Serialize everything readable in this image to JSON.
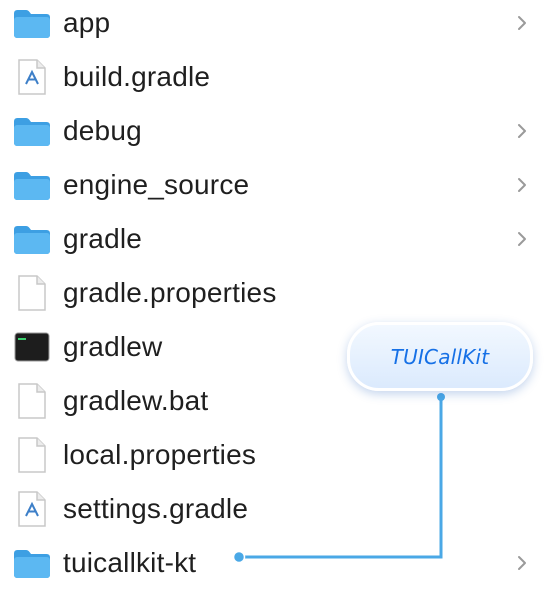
{
  "files": [
    {
      "name": "app",
      "type": "folder",
      "icon": "folder-icon",
      "expandable": true
    },
    {
      "name": "build.gradle",
      "type": "gradle",
      "icon": "gradle-file-icon",
      "expandable": false
    },
    {
      "name": "debug",
      "type": "folder",
      "icon": "folder-icon",
      "expandable": true
    },
    {
      "name": "engine_source",
      "type": "folder",
      "icon": "folder-icon",
      "expandable": true
    },
    {
      "name": "gradle",
      "type": "folder",
      "icon": "folder-icon",
      "expandable": true
    },
    {
      "name": "gradle.properties",
      "type": "document",
      "icon": "document-icon",
      "expandable": false
    },
    {
      "name": "gradlew",
      "type": "executable",
      "icon": "terminal-icon",
      "expandable": false
    },
    {
      "name": "gradlew.bat",
      "type": "document",
      "icon": "document-icon",
      "expandable": false
    },
    {
      "name": "local.properties",
      "type": "document",
      "icon": "document-icon",
      "expandable": false
    },
    {
      "name": "settings.gradle",
      "type": "gradle",
      "icon": "gradle-file-icon",
      "expandable": false
    },
    {
      "name": "tuicallkit-kt",
      "type": "folder",
      "icon": "folder-icon",
      "expandable": true
    }
  ],
  "callout": {
    "label": "TUICallKit"
  },
  "colors": {
    "folder": "#4aaef0",
    "accent": "#1670e6",
    "chevron": "#9a9a9a",
    "text": "#1f1f1f"
  }
}
